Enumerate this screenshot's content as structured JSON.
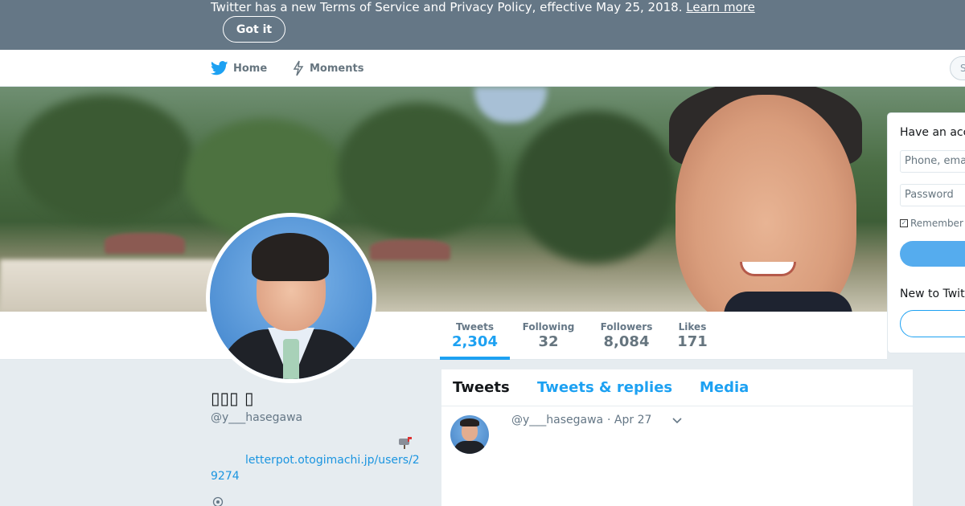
{
  "banner": {
    "text": "Twitter has a new Terms of Service and Privacy Policy, effective May 25, 2018.",
    "link_label": "Learn more",
    "button_label": "Got it"
  },
  "nav": {
    "home_label": "Home",
    "moments_label": "Moments",
    "search_placeholder": "S"
  },
  "login": {
    "title": "Have an acc",
    "username_placeholder": "Phone, ema",
    "password_placeholder": "Password",
    "remember_label": "Remember",
    "new_label": "New to Twit"
  },
  "profile": {
    "name": "▯▯▯ ▯",
    "handle": "@y___hasegawa",
    "link": "letterpot.otogimachi.jp/users/29274"
  },
  "stats": [
    {
      "label": "Tweets",
      "value": "2,304"
    },
    {
      "label": "Following",
      "value": "32"
    },
    {
      "label": "Followers",
      "value": "8,084"
    },
    {
      "label": "Likes",
      "value": "171"
    }
  ],
  "timeline": {
    "tabs": [
      "Tweets",
      "Tweets & replies",
      "Media"
    ],
    "tweet": {
      "handle": "@y___hasegawa",
      "date": "· Apr 27"
    }
  },
  "colors": {
    "accent": "#1da1f2",
    "banner": "#657786",
    "link": "#1b95e0"
  }
}
